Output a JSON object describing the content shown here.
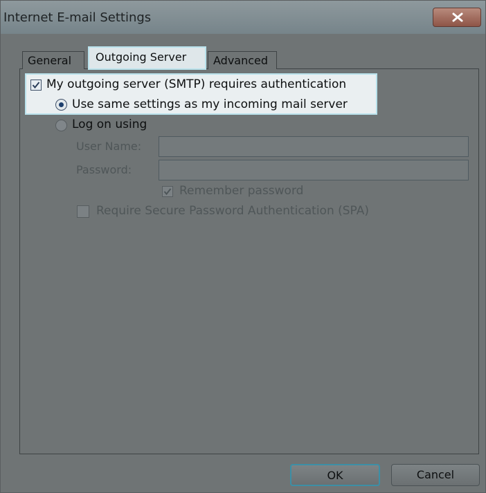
{
  "window": {
    "title": "Internet E-mail Settings",
    "close_glyph": "x"
  },
  "tabs": [
    {
      "label": "General",
      "selected": false
    },
    {
      "label": "Outgoing Server",
      "selected": true
    },
    {
      "label": "Advanced",
      "selected": false
    }
  ],
  "outgoing": {
    "requires_auth": {
      "label": "My outgoing server (SMTP) requires authentication",
      "checked": true
    },
    "same_settings": {
      "label": "Use same settings as my incoming mail server",
      "selected": true
    },
    "log_on_using": {
      "label": "Log on using",
      "selected": false
    },
    "user_name": {
      "label": "User Name:",
      "value": ""
    },
    "password": {
      "label": "Password:",
      "value": ""
    },
    "remember_password": {
      "label": "Remember password",
      "checked": true
    },
    "require_spa": {
      "label": "Require Secure Password Authentication (SPA)",
      "checked": false
    }
  },
  "buttons": {
    "ok_label": "OK",
    "cancel_label": "Cancel"
  },
  "colors": {
    "highlight": "#b9e2ec",
    "background": "#6f7475"
  }
}
